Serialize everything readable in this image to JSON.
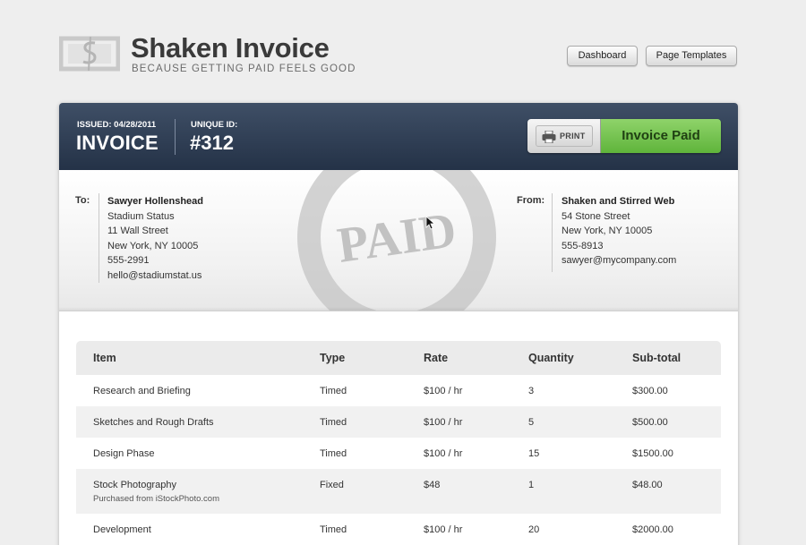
{
  "app": {
    "title": "Shaken Invoice",
    "tagline": "BECAUSE GETTING PAID FEELS GOOD",
    "logo_icon": "dollar-sign-icon"
  },
  "nav": {
    "dashboard": "Dashboard",
    "page_templates": "Page Templates"
  },
  "invoice": {
    "issued_label": "ISSUED: 04/28/2011",
    "title": "INVOICE",
    "uid_label": "UNIQUE ID:",
    "uid_value": "#312",
    "print_label": "PRINT",
    "print_icon": "printer-icon",
    "paid_label": "Invoice Paid",
    "stamp_text": "PAID",
    "colors": {
      "header": "#2c3a50",
      "paid_button": "#6cbf45",
      "stamp": "#bdbdbd"
    }
  },
  "to": {
    "label": "To:",
    "name": "Sawyer Hollenshead",
    "lines": [
      "Stadium Status",
      "11 Wall Street",
      "New York, NY 10005",
      "555-2991",
      "hello@stadiumstat.us"
    ]
  },
  "from": {
    "label": "From:",
    "name": "Shaken and Stirred Web",
    "lines": [
      "54 Stone Street",
      "New York, NY 10005",
      "555-8913",
      "sawyer@mycompany.com"
    ]
  },
  "items": {
    "headers": [
      "Item",
      "Type",
      "Rate",
      "Quantity",
      "Sub-total"
    ],
    "rows": [
      {
        "item": "Research and Briefing",
        "note": "",
        "type": "Timed",
        "rate": "$100 / hr",
        "quantity": "3",
        "subtotal": "$300.00"
      },
      {
        "item": "Sketches and Rough Drafts",
        "note": "",
        "type": "Timed",
        "rate": "$100 / hr",
        "quantity": "5",
        "subtotal": "$500.00"
      },
      {
        "item": "Design Phase",
        "note": "",
        "type": "Timed",
        "rate": "$100 / hr",
        "quantity": "15",
        "subtotal": "$1500.00"
      },
      {
        "item": "Stock Photography",
        "note": "Purchased from iStockPhoto.com",
        "type": "Fixed",
        "rate": "$48",
        "quantity": "1",
        "subtotal": "$48.00"
      },
      {
        "item": "Development",
        "note": "",
        "type": "Timed",
        "rate": "$100 / hr",
        "quantity": "20",
        "subtotal": "$2000.00"
      }
    ]
  }
}
